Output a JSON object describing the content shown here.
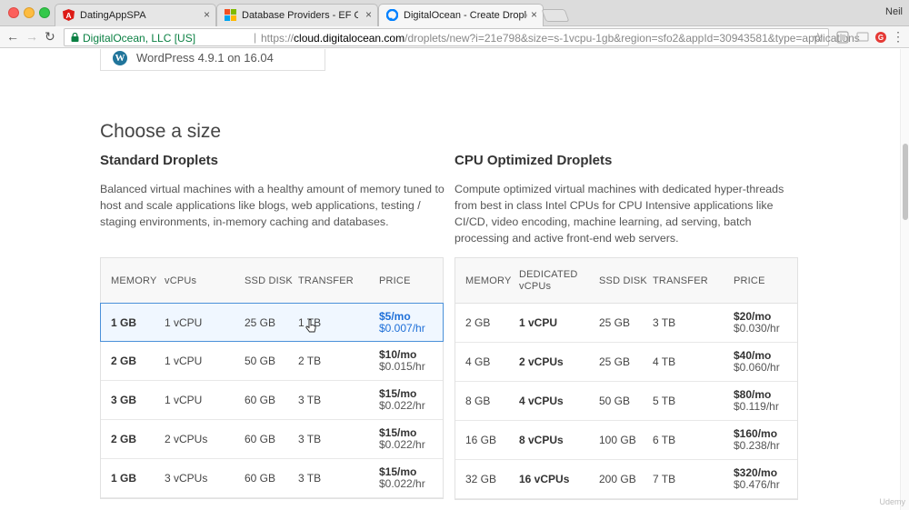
{
  "browser": {
    "tabs": [
      {
        "label": "DatingAppSPA",
        "icon": "angular-icon"
      },
      {
        "label": "Database Providers - EF Core",
        "icon": "microsoft-icon"
      },
      {
        "label": "DigitalOcean - Create Droplets",
        "icon": "digitalocean-icon"
      }
    ],
    "close_glyph": "×",
    "profile": "Neil",
    "secure_label": "DigitalOcean, LLC [US]",
    "url_scheme": "https://",
    "url_domain": "cloud.digitalocean.com",
    "url_path": "/droplets/new?i=21e798&size=s-1vcpu-1gb&region=sfo2&appId=30943581&type=applications"
  },
  "image_card": {
    "label": "WordPress 4.9.1 on 16.04"
  },
  "section_title": "Choose a size",
  "standard": {
    "title": "Standard Droplets",
    "description": "Balanced virtual machines with a healthy amount of memory tuned to host and scale applications like blogs, web applications, testing / staging environments, in-memory caching and databases.",
    "headers": [
      "MEMORY",
      "vCPUs",
      "SSD DISK",
      "TRANSFER",
      "PRICE"
    ],
    "rows": [
      {
        "memory": "1 GB",
        "vcpus": "1 vCPU",
        "disk": "25 GB",
        "transfer": "1 TB",
        "price_mo": "$5/mo",
        "price_hr": "$0.007/hr",
        "selected": true
      },
      {
        "memory": "2 GB",
        "vcpus": "1 vCPU",
        "disk": "50 GB",
        "transfer": "2 TB",
        "price_mo": "$10/mo",
        "price_hr": "$0.015/hr"
      },
      {
        "memory": "3 GB",
        "vcpus": "1 vCPU",
        "disk": "60 GB",
        "transfer": "3 TB",
        "price_mo": "$15/mo",
        "price_hr": "$0.022/hr"
      },
      {
        "memory": "2 GB",
        "vcpus": "2 vCPUs",
        "disk": "60 GB",
        "transfer": "3 TB",
        "price_mo": "$15/mo",
        "price_hr": "$0.022/hr"
      },
      {
        "memory": "1 GB",
        "vcpus": "3 vCPUs",
        "disk": "60 GB",
        "transfer": "3 TB",
        "price_mo": "$15/mo",
        "price_hr": "$0.022/hr"
      }
    ]
  },
  "cpu_optimized": {
    "title": "CPU Optimized Droplets",
    "description": "Compute optimized virtual machines with dedicated hyper-threads from best in class Intel CPUs for CPU Intensive applications like CI/CD, video encoding, machine learning, ad serving, batch processing and active front-end web servers.",
    "headers": [
      "MEMORY",
      "DEDICATED vCPUs",
      "SSD DISK",
      "TRANSFER",
      "PRICE"
    ],
    "rows": [
      {
        "memory": "2 GB",
        "vcpus": "1 vCPU",
        "disk": "25 GB",
        "transfer": "3 TB",
        "price_mo": "$20/mo",
        "price_hr": "$0.030/hr"
      },
      {
        "memory": "4 GB",
        "vcpus": "2 vCPUs",
        "disk": "25 GB",
        "transfer": "4 TB",
        "price_mo": "$40/mo",
        "price_hr": "$0.060/hr"
      },
      {
        "memory": "8 GB",
        "vcpus": "4 vCPUs",
        "disk": "50 GB",
        "transfer": "5 TB",
        "price_mo": "$80/mo",
        "price_hr": "$0.119/hr"
      },
      {
        "memory": "16 GB",
        "vcpus": "8 vCPUs",
        "disk": "100 GB",
        "transfer": "6 TB",
        "price_mo": "$160/mo",
        "price_hr": "$0.238/hr"
      },
      {
        "memory": "32 GB",
        "vcpus": "16 vCPUs",
        "disk": "200 GB",
        "transfer": "7 TB",
        "price_mo": "$320/mo",
        "price_hr": "$0.476/hr"
      }
    ]
  },
  "watermark": "Udemy",
  "colors": {
    "accent": "#1e6fd8",
    "secure": "#0b8043",
    "selected_border": "#4a90d9"
  }
}
